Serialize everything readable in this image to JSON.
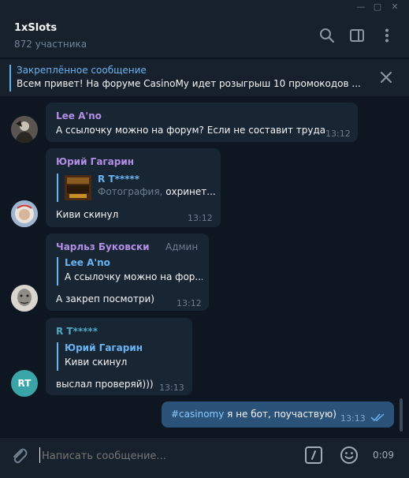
{
  "window": {
    "minimize": "—",
    "maximize": "▢",
    "close": "✕"
  },
  "header": {
    "title": "1xSlots",
    "subtitle": "872 участника"
  },
  "pinned": {
    "title": "Закреплённое сообщение",
    "text": "Всем привет! На форуме CasinoMy идет розыгрыш 10 промокодов ..."
  },
  "messages": [
    {
      "sender": "Lee A'no",
      "text": "А ссылочку можно на форум? Если не составит труда",
      "time": "13:12"
    },
    {
      "sender": "Юрий Гагарин",
      "reply_name": "R T*****",
      "reply_kind": "Фотография,",
      "reply_text": " охринет...",
      "text": "Киви скинул",
      "time": "13:12"
    },
    {
      "sender": "Чарльз Буковски",
      "role": "Админ",
      "reply_name": "Lee A'no",
      "reply_text": "А ссылочку можно на фор...",
      "text": "А закреп посмотри)",
      "time": "13:12"
    },
    {
      "sender": "R T*****",
      "avatar_initials": "RT",
      "reply_name": "Юрий Гагарин",
      "reply_text": "Киви скинул",
      "text": "выслал проверяй)))",
      "time": "13:13"
    }
  ],
  "outgoing": {
    "hashtag": "#casinomy",
    "text": " я не бот, поучаствую)",
    "time": "13:13"
  },
  "input": {
    "placeholder": "Написать сообщение...",
    "voice_time": "0:09"
  },
  "colors": {
    "accent": "#6ab3f3",
    "sender_purple": "#b38ee5",
    "sender_teal": "#4fa7c4",
    "outgoing_bubble": "#2b5278"
  }
}
